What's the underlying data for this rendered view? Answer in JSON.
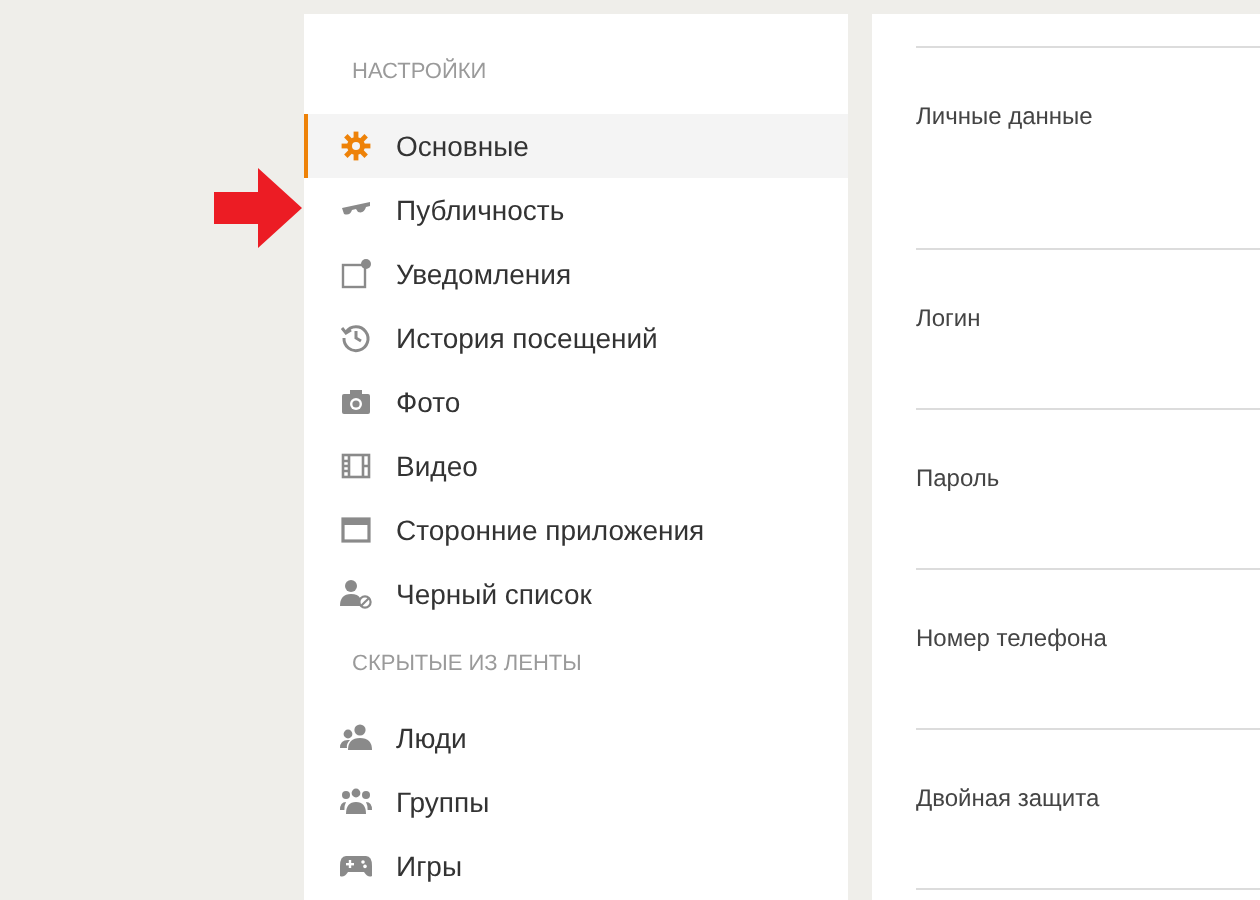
{
  "sidebar": {
    "sections": [
      {
        "title": "НАСТРОЙКИ",
        "items": [
          {
            "label": "Основные",
            "selected": true
          },
          {
            "label": "Публичность",
            "selected": false
          },
          {
            "label": "Уведомления",
            "selected": false
          },
          {
            "label": "История посещений",
            "selected": false
          },
          {
            "label": "Фото",
            "selected": false
          },
          {
            "label": "Видео",
            "selected": false
          },
          {
            "label": "Сторонние приложения",
            "selected": false
          },
          {
            "label": "Черный список",
            "selected": false
          }
        ]
      },
      {
        "title": "СКРЫТЫЕ ИЗ ЛЕНТЫ",
        "items": [
          {
            "label": "Люди",
            "selected": false
          },
          {
            "label": "Группы",
            "selected": false
          },
          {
            "label": "Игры",
            "selected": false
          }
        ]
      }
    ]
  },
  "settings": {
    "rows": [
      {
        "label": "Личные данные"
      },
      {
        "label": "Логин"
      },
      {
        "label": "Пароль"
      },
      {
        "label": "Номер телефона"
      },
      {
        "label": "Двойная защита"
      }
    ]
  }
}
